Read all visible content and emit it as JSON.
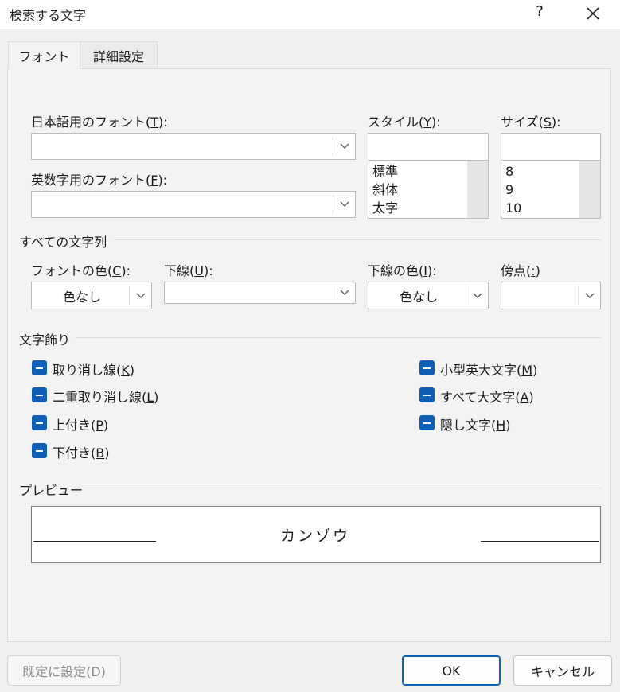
{
  "window": {
    "title": "検索する文字",
    "help": "?",
    "close": "✕"
  },
  "tabs": [
    {
      "label": "フォント"
    },
    {
      "label": "詳細設定"
    }
  ],
  "font": {
    "jp_label_pre": "日本語用のフォント(",
    "jp_label_key": "T",
    "jp_label_post": "):",
    "jp_value": "",
    "en_label_pre": "英数字用のフォント(",
    "en_label_key": "F",
    "en_label_post": "):",
    "en_value": "",
    "style_label_pre": "スタイル(",
    "style_label_key": "Y",
    "style_label_post": "):",
    "style_value": "",
    "style_options": [
      "標準",
      "斜体",
      "太字"
    ],
    "size_label_pre": "サイズ(",
    "size_label_key": "S",
    "size_label_post": "):",
    "size_value": "",
    "size_options": [
      "8",
      "9",
      "10"
    ]
  },
  "all_text": {
    "section": "すべての文字列",
    "color_label_pre": "フォントの色(",
    "color_label_key": "C",
    "color_label_post": "):",
    "color_value": "色なし",
    "underline_label_pre": "下線(",
    "underline_label_key": "U",
    "underline_label_post": "):",
    "underline_value": "",
    "underline_color_label_pre": "下線の色(",
    "underline_color_label_key": "I",
    "underline_color_label_post": "):",
    "underline_color_value": "色なし",
    "emphasis_label_pre": "傍点(",
    "emphasis_label_key": ":",
    "emphasis_label_post": ")",
    "emphasis_value": ""
  },
  "effects": {
    "section": "文字飾り",
    "left": [
      {
        "pre": "取り消し線(",
        "key": "K",
        "post": ")"
      },
      {
        "pre": "二重取り消し線(",
        "key": "L",
        "post": ")"
      },
      {
        "pre": "上付き(",
        "key": "P",
        "post": ")"
      },
      {
        "pre": "下付き(",
        "key": "B",
        "post": ")"
      }
    ],
    "right": [
      {
        "pre": "小型英大文字(",
        "key": "M",
        "post": ")"
      },
      {
        "pre": "すべて大文字(",
        "key": "A",
        "post": ")"
      },
      {
        "pre": "隠し文字(",
        "key": "H",
        "post": ")"
      }
    ],
    "state": "indeterminate"
  },
  "preview": {
    "section": "プレビュー",
    "text": "カンゾウ"
  },
  "buttons": {
    "default": "既定に設定(D)",
    "ok": "OK",
    "cancel": "キャンセル"
  },
  "colors": {
    "checkbox": "#0f5fb6",
    "accent": "#0f5fb6"
  }
}
